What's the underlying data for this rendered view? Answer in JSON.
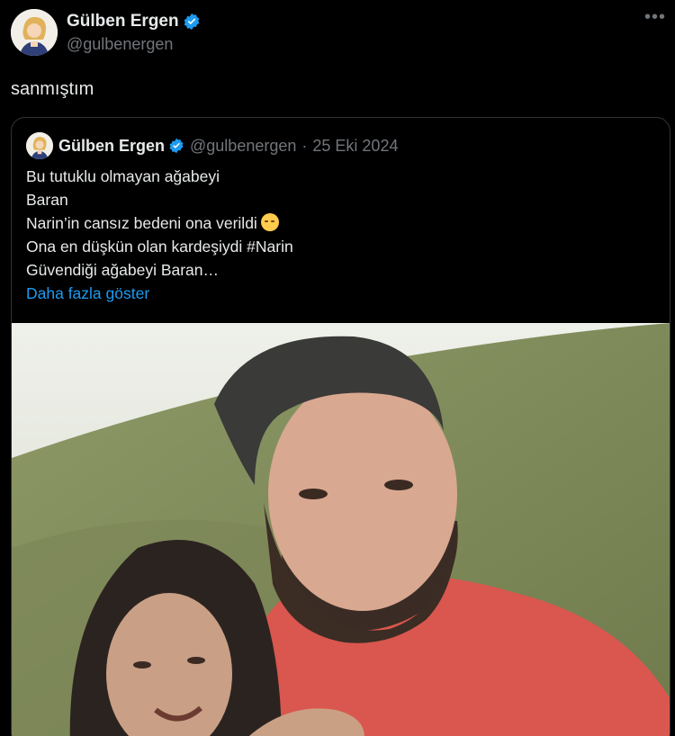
{
  "tweet": {
    "display_name": "Gülben Ergen",
    "handle": "@gulbenergen",
    "text": "sanmıştım",
    "more_icon": "•••"
  },
  "quoted": {
    "display_name": "Gülben Ergen",
    "handle": "@gulbenergen",
    "separator": "·",
    "date": "25 Eki 2024",
    "lines": [
      "Bu tutuklu olmayan ağabeyi",
      "Baran",
      "Narin’in cansız bedeni ona verildi",
      "Ona en düşkün olan kardeşiydi #Narin",
      "Güvendiği ağabeyi Baran…"
    ],
    "emoji": "pensive-face",
    "show_more": "Daha fazla göster"
  },
  "colors": {
    "background": "#000000",
    "text": "#e7e9ea",
    "secondary": "#71767b",
    "accent": "#1d9bf0",
    "border": "#2f3336"
  }
}
